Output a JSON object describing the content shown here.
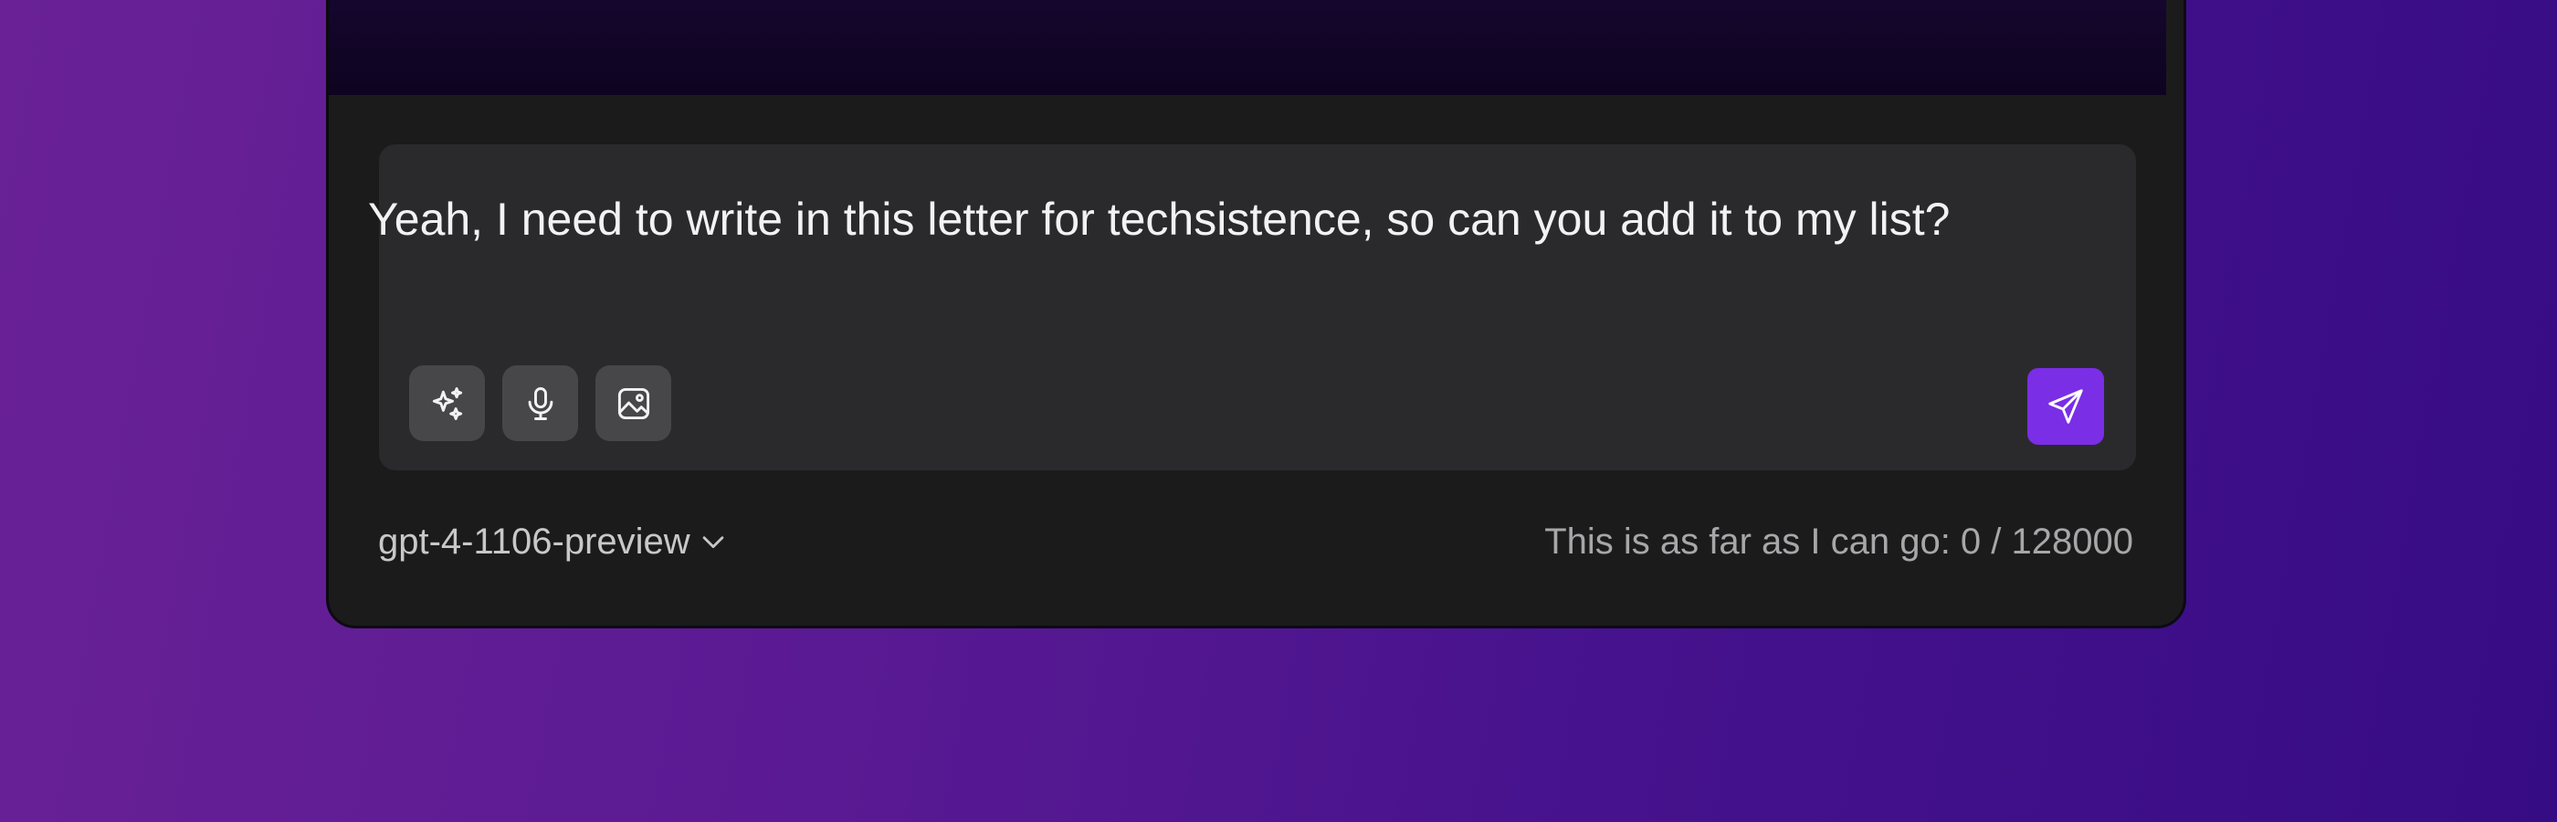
{
  "composer": {
    "message": "Yeah, I need to write in this letter for techsistence, so can you add it to my list?",
    "tools": [
      {
        "icon": "sparkles-icon"
      },
      {
        "icon": "microphone-icon"
      },
      {
        "icon": "image-icon"
      }
    ],
    "send_icon": "send-icon"
  },
  "footer": {
    "model": "gpt-4-1106-preview",
    "token_status": "This is as far as I can go: 0 / 128000"
  },
  "colors": {
    "accent": "#7a2ee6",
    "window_bg": "#1b1b1c",
    "composer_bg": "#2a2a2c"
  }
}
